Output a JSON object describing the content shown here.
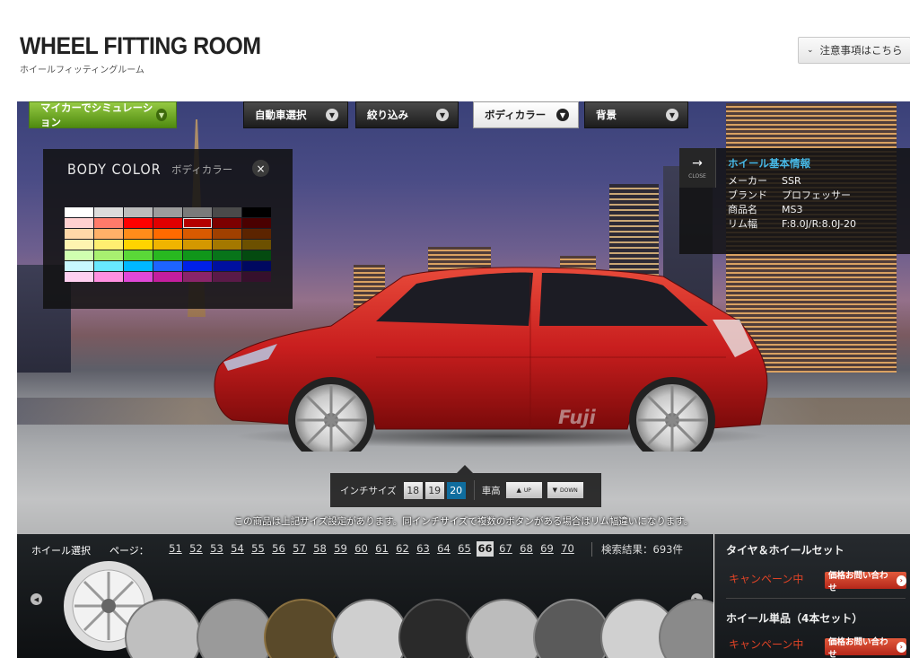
{
  "header": {
    "title": "WHEEL FITTING ROOM",
    "subtitle": "ホイールフィッティングルーム",
    "notice_button": "注意事項はこちら"
  },
  "tabs": [
    {
      "label": "マイカーでシミュレーション",
      "style": "green"
    },
    {
      "label": "自動車選択",
      "style": "dark"
    },
    {
      "label": "絞り込み",
      "style": "dark"
    },
    {
      "label": "ボディカラー",
      "style": "active"
    },
    {
      "label": "背景",
      "style": "dark"
    }
  ],
  "body_color": {
    "title": "BODY COLOR",
    "subtitle": "ボディカラー",
    "close_icon": "×",
    "selected": "#b40000",
    "rows": [
      [
        "#ffffff",
        "#dcdcdc",
        "#bcbcbc",
        "#9c9c9c",
        "#7a7a7a",
        "#4a4a4a",
        "#000000"
      ],
      [
        "#ffd0d0",
        "#ff7a6a",
        "#ff0000",
        "#e00000",
        "#b40000",
        "#7c0000",
        "#4a0000"
      ],
      [
        "#ffd8a8",
        "#ffb068",
        "#ff8c1a",
        "#ff6a00",
        "#d95a00",
        "#a04000",
        "#5c2400"
      ],
      [
        "#fff4b0",
        "#ffee70",
        "#ffd400",
        "#f0b400",
        "#d49800",
        "#a47800",
        "#6c5000"
      ],
      [
        "#d0ffb0",
        "#a8f070",
        "#5ad838",
        "#28b820",
        "#10961a",
        "#08741a",
        "#044a10"
      ],
      [
        "#c8f8ff",
        "#68e8ff",
        "#00b8ff",
        "#1e64ff",
        "#0020e8",
        "#0010a0",
        "#000860"
      ],
      [
        "#ffd0f0",
        "#ff90e0",
        "#e048d8",
        "#c41e9e",
        "#8a246a",
        "#5a1a48",
        "#36102c"
      ]
    ]
  },
  "info": {
    "close_label": "CLOSE",
    "title": "ホイール基本情報",
    "rows": [
      {
        "key": "メーカー",
        "value": "SSR"
      },
      {
        "key": "ブランド",
        "value": "プロフェッサー"
      },
      {
        "key": "商品名",
        "value": "MS3"
      },
      {
        "key": "リム幅",
        "value": "F:8.0J/R:8.0J-20"
      }
    ]
  },
  "car": {
    "body_color": "#c81e1e",
    "watermark": "Fuji"
  },
  "size_bar": {
    "inch_label": "インチサイズ",
    "inches": [
      "18",
      "19",
      "20"
    ],
    "selected_inch": "20",
    "height_label": "車高",
    "up_label": "UP",
    "down_label": "DOWN"
  },
  "note": "この商品は上記サイズ設定があります。同インチサイズで複数のボタンがある場合はリム幅違いになります。",
  "wheel_select": {
    "label": "ホイール選択",
    "page_label": "ページ：",
    "pages": [
      "51",
      "52",
      "53",
      "54",
      "55",
      "56",
      "57",
      "58",
      "59",
      "60",
      "61",
      "62",
      "63",
      "64",
      "65",
      "66",
      "67",
      "68",
      "69",
      "70"
    ],
    "current_page": "66",
    "results": "検索結果：693件"
  },
  "shop": {
    "set_title": "タイヤ＆ホイールセット",
    "single_title": "ホイール単品（4本セット）",
    "campaign": "キャンペーン中",
    "inquiry": "価格お問い合わせ"
  }
}
